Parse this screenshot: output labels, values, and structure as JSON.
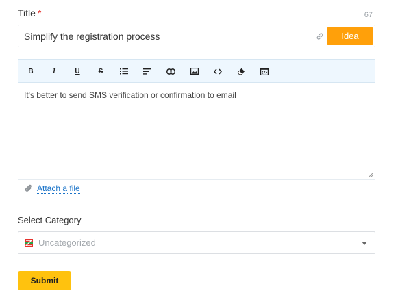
{
  "form": {
    "title_label": "Title",
    "required_mark": "*",
    "char_count": "67",
    "title_value": "Simplify the registration process",
    "idea_button": "Idea",
    "editor": {
      "toolbar": [
        {
          "name": "bold",
          "label": "B"
        },
        {
          "name": "italic",
          "label": "I"
        },
        {
          "name": "underline",
          "label": "U"
        },
        {
          "name": "strikethrough",
          "label": "S"
        },
        {
          "name": "bullet-list",
          "label": ""
        },
        {
          "name": "align",
          "label": ""
        },
        {
          "name": "link",
          "label": ""
        },
        {
          "name": "image",
          "label": ""
        },
        {
          "name": "code",
          "label": ""
        },
        {
          "name": "eraser",
          "label": ""
        },
        {
          "name": "html-source",
          "label": ""
        }
      ],
      "content": "It's better to send SMS verification or confirmation to email",
      "attach_label": "Attach a file"
    },
    "category_label": "Select Category",
    "category_value": "Uncategorized",
    "submit_label": "Submit"
  },
  "colors": {
    "accent_orange": "#ffa00a",
    "submit_yellow": "#ffc20e",
    "toolbar_bg": "#eef7fe",
    "link_blue": "#1a73c8",
    "required_red": "#e5322d"
  }
}
